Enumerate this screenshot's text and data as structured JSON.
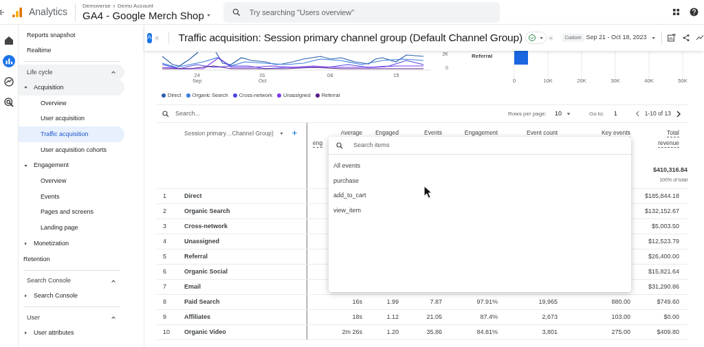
{
  "header": {
    "product": "Analytics",
    "breadcrumb": [
      "Demoverse",
      "Demo Account"
    ],
    "property": "GA4 - Google Merch Shop",
    "search": {
      "placeholder": "Try searching \"Users overview\""
    }
  },
  "rail": [
    {
      "kind": "home",
      "selected": false
    },
    {
      "kind": "reports",
      "selected": true
    },
    {
      "kind": "explore",
      "selected": false
    },
    {
      "kind": "advertising",
      "selected": false
    }
  ],
  "sidebar": {
    "top_items": [
      {
        "label": "Reports snapshot",
        "selected": false
      },
      {
        "label": "Realtime",
        "selected": false
      }
    ],
    "sections": [
      {
        "title": "Life cycle",
        "expanded": true,
        "highlighted": true,
        "items": [
          {
            "kind": "group",
            "label": "Acquisition",
            "expanded": true,
            "selected": false,
            "highlighted": true,
            "children": [
              {
                "label": "Overview",
                "selected": false
              },
              {
                "label": "User acquisition",
                "selected": false
              },
              {
                "label": "Traffic acquisition",
                "selected": true
              },
              {
                "label": "User acquisition cohorts",
                "selected": false
              }
            ]
          },
          {
            "kind": "group",
            "label": "Engagement",
            "expanded": true,
            "selected": false,
            "highlighted": false,
            "children": [
              {
                "label": "Overview",
                "selected": false
              },
              {
                "label": "Events",
                "selected": false
              },
              {
                "label": "Pages and screens",
                "selected": false
              },
              {
                "label": "Landing page",
                "selected": false
              }
            ]
          },
          {
            "kind": "group",
            "label": "Monetization",
            "expanded": false,
            "selected": false,
            "highlighted": false
          },
          {
            "kind": "link",
            "label": "Retention",
            "selected": false,
            "highlighted": false
          }
        ]
      },
      {
        "title": "Search Console",
        "expanded": true,
        "highlighted": false,
        "items": [
          {
            "kind": "group",
            "label": "Search Console",
            "expanded": false,
            "selected": false,
            "highlighted": false
          }
        ]
      },
      {
        "title": "User",
        "expanded": true,
        "highlighted": false,
        "items": [
          {
            "kind": "group",
            "label": "User attributes",
            "expanded": false,
            "selected": false,
            "highlighted": false
          }
        ]
      }
    ]
  },
  "report": {
    "comparison_badge": "A",
    "title": "Traffic acquisition: Session primary channel group (Default Channel Group)",
    "date_badge": "Custom",
    "date_range": "Sep 21 - Oct 18, 2023"
  },
  "line_chart": {
    "y_ticks": [
      "2K",
      "0"
    ],
    "x_labels": [
      {
        "day": "24",
        "month": "Sep"
      },
      {
        "day": "01",
        "month": "Oct"
      },
      {
        "day": "08"
      },
      {
        "day": "15"
      }
    ],
    "legend": [
      {
        "name": "Direct",
        "color": "#2b5fab"
      },
      {
        "name": "Organic Search",
        "color": "#3b7ddd"
      },
      {
        "name": "Cross-network",
        "color": "#4f46e5"
      },
      {
        "name": "Unassigned",
        "color": "#7c3aed"
      },
      {
        "name": "Referral",
        "color": "#581c87"
      }
    ]
  },
  "bar_chart": {
    "category": "Referral",
    "x_ticks": [
      "0",
      "10K",
      "20K",
      "30K",
      "40K",
      "50K"
    ]
  },
  "table": {
    "search": {
      "placeholder": "Search..."
    },
    "rows_per_page_label": "Rows per page:",
    "rows_per_page": "10",
    "goto_label": "Go to:",
    "goto_value": "1",
    "page_info": "1-10 of 13",
    "dimension_header": "Session primary…Channel Group)",
    "columns": [
      {
        "label": "Average",
        "label_line2": "eng"
      },
      {
        "label": "Engaged"
      },
      {
        "label": "Events"
      },
      {
        "label": "Engagement"
      },
      {
        "label": "Event count"
      },
      {
        "label": "Key events"
      },
      {
        "label": "Total",
        "label_line2": "revenue"
      }
    ],
    "totals": {
      "total_revenue": "$410,316.84",
      "share": "100% of total"
    },
    "rows": [
      {
        "index": "1",
        "channel": "Direct",
        "total_revenue": "$185,844.18"
      },
      {
        "index": "2",
        "channel": "Organic Search",
        "total_revenue": "$132,152.67"
      },
      {
        "index": "3",
        "channel": "Cross-network",
        "total_revenue": "$5,003.50"
      },
      {
        "index": "4",
        "channel": "Unassigned",
        "total_revenue": "$12,523.79"
      },
      {
        "index": "5",
        "channel": "Referral",
        "total_revenue": "$26,400.00"
      },
      {
        "index": "6",
        "channel": "Organic Social",
        "total_revenue": "$15,821.64"
      },
      {
        "index": "7",
        "channel": "Email",
        "total_revenue": "$31,290.86"
      },
      {
        "index": "8",
        "channel": "Paid Search",
        "metrics": [
          "16s",
          "1.99",
          "7.87",
          "97.91%",
          "19,965",
          "880.00",
          "$749.60"
        ]
      },
      {
        "index": "9",
        "channel": "Affiliates",
        "metrics": [
          "18s",
          "1.12",
          "21.05",
          "87.4%",
          "2,673",
          "103.00",
          "$0.00"
        ]
      },
      {
        "index": "10",
        "channel": "Organic Video",
        "metrics": [
          "2m 26s",
          "1.20",
          "35.86",
          "84.81%",
          "3,801",
          "275.00",
          "$409.80"
        ]
      }
    ]
  },
  "event_picker": {
    "search": {
      "placeholder": "Search items"
    },
    "items": [
      {
        "label": "All events"
      },
      {
        "label": "purchase"
      },
      {
        "label": "add_to_cart"
      },
      {
        "label": "view_item"
      }
    ]
  }
}
